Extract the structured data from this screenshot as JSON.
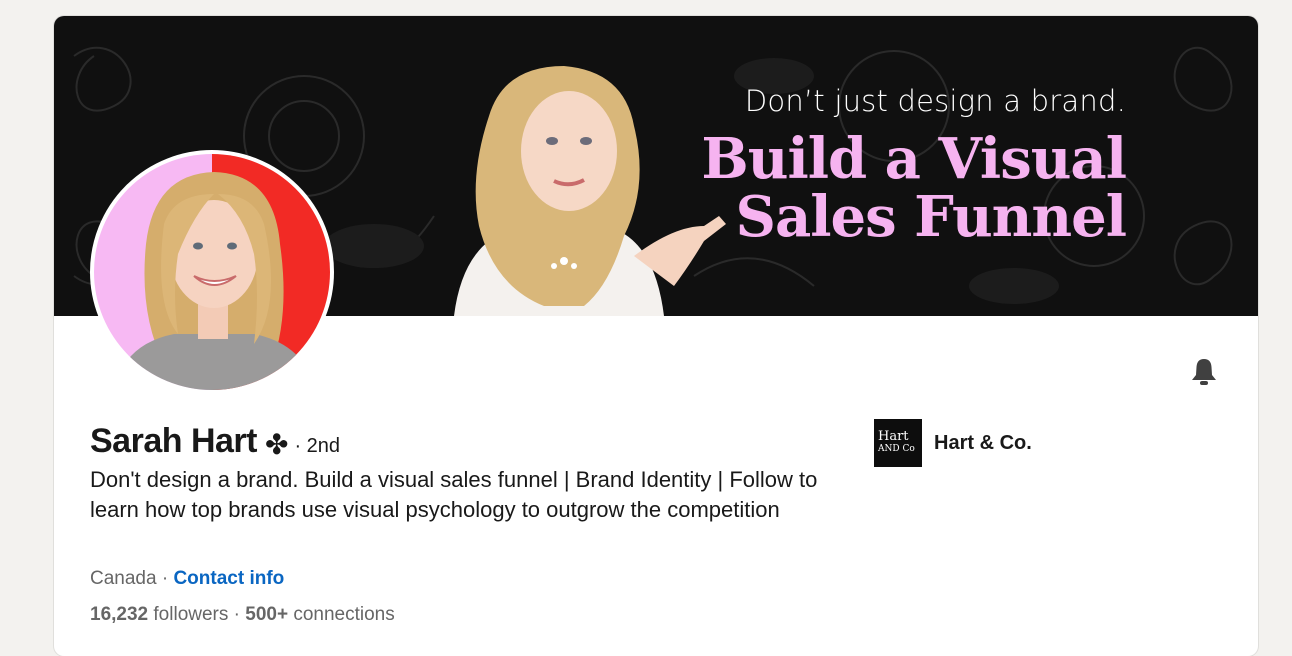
{
  "banner": {
    "line1": "Don’t just design a brand.",
    "line2": "Build a Visual Sales Funnel"
  },
  "profile": {
    "name": "Sarah Hart",
    "badge": "✤",
    "degree": "· 2nd",
    "headline": "Don't design a brand. Build a visual sales funnel | Brand Identity | Follow to learn how top brands use visual psychology to outgrow the competition",
    "location": "Canada",
    "separator": " · ",
    "contact_label": "Contact info",
    "followers_count": "16,232",
    "followers_label": " followers",
    "stats_separator": "  · ",
    "connections_count": "500+",
    "connections_label": " connections"
  },
  "company": {
    "logo_line1": "Hart",
    "logo_line2": "AND Co",
    "name": "Hart & Co."
  },
  "icons": {
    "bell": "bell-icon",
    "clover": "clover-icon"
  },
  "colors": {
    "accent_pink": "#f6b3f0",
    "link_blue": "#0a66c2",
    "avatar_left": "#f7b9f3",
    "avatar_right": "#f22a25"
  }
}
